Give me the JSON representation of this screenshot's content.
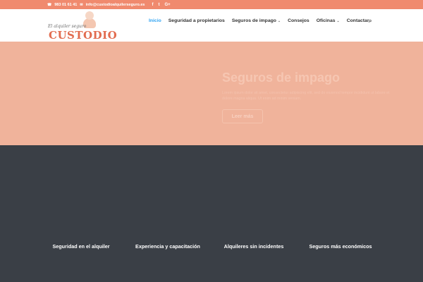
{
  "topbar": {
    "phone": "983 01 61 41",
    "email": "info@custodioalquilerseguro.es",
    "social": [
      "f",
      "t",
      "G+"
    ]
  },
  "logo": {
    "tagline": "El alquiler seguro",
    "brand": "CUSTODIO"
  },
  "nav": {
    "items": [
      {
        "label": "Inicio",
        "active": true
      },
      {
        "label": "Seguridad a propietarios"
      },
      {
        "label": "Seguros de impago",
        "chevron": "⌄"
      },
      {
        "label": "Consejos"
      },
      {
        "label": "Oficinas",
        "chevron": "⌄"
      },
      {
        "label": "Contactar"
      }
    ]
  },
  "hero": {
    "title": "Seguros de impago",
    "description": "Lorem ipsum dolor sit amet, consectetur adipiscing elit, sed do eiusmod tempor incididunt ut labore et dolore magna aliqua. Ut enim ad minim veniam.",
    "button": "Leer más"
  },
  "features": [
    {
      "label": "Seguridad en el alquiler"
    },
    {
      "label": "Experiencia y capacitación"
    },
    {
      "label": "Alquileres sin incidentes"
    },
    {
      "label": "Seguros más económicos"
    }
  ],
  "colors": {
    "topbar": "#f08a6e",
    "hero": "#f0b39b",
    "dark": "#3a3f46",
    "accent": "#2ea3f2",
    "brand": "#e26c4f"
  }
}
